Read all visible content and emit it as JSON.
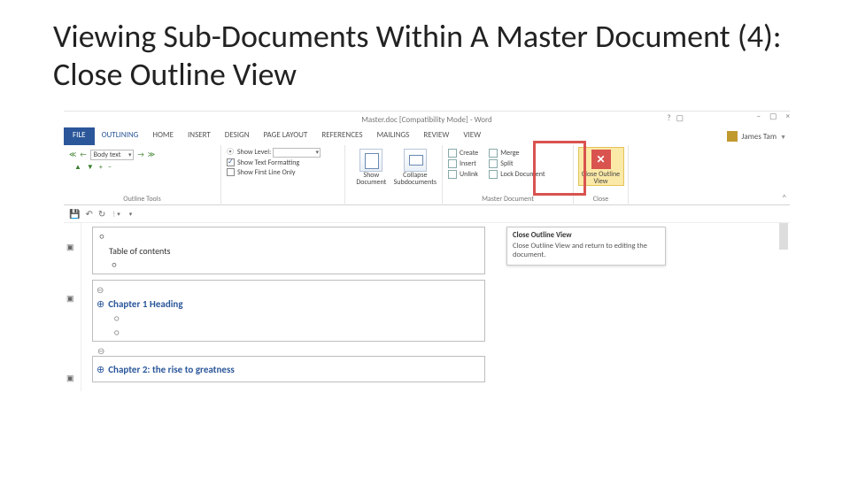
{
  "slide": {
    "title": "Viewing Sub-Documents Within A Master Document (4): Close Outline View"
  },
  "titlebar": {
    "title": "Master.doc [Compatibility Mode] - Word"
  },
  "win": {
    "help": "?",
    "ribbonopts": "▢",
    "min": "–",
    "max": "▢",
    "close": "×"
  },
  "user": {
    "name": "James Tam"
  },
  "tabs": {
    "file": "FILE",
    "outlining": "OUTLINING",
    "home": "HOME",
    "insert": "INSERT",
    "design": "DESIGN",
    "pagelayout": "PAGE LAYOUT",
    "references": "REFERENCES",
    "mailings": "MAILINGS",
    "review": "REVIEW",
    "view": "VIEW"
  },
  "ribbon": {
    "level_combo": "Body text",
    "show_level_label": "Show Level:",
    "show_text_formatting": "Show Text Formatting",
    "show_first_line": "Show First Line Only",
    "group_outline": "Outline Tools",
    "show_document": "Show Document",
    "collapse_subdocs": "Collapse Subdocuments",
    "create": "Create",
    "insert": "Insert",
    "unlink": "Unlink",
    "merge": "Merge",
    "split": "Split",
    "lock": "Lock Document",
    "group_master": "Master Document",
    "close_outline": "Close Outline View",
    "group_close": "Close",
    "collapse_ribbon": "^"
  },
  "tooltip": {
    "title": "Close Outline View",
    "body": "Close Outline View and return to editing the document."
  },
  "outline": {
    "toc_label": "Table of contents",
    "chapter1": "Chapter 1 Heading",
    "chapter2": "Chapter 2: the rise to greatness"
  }
}
